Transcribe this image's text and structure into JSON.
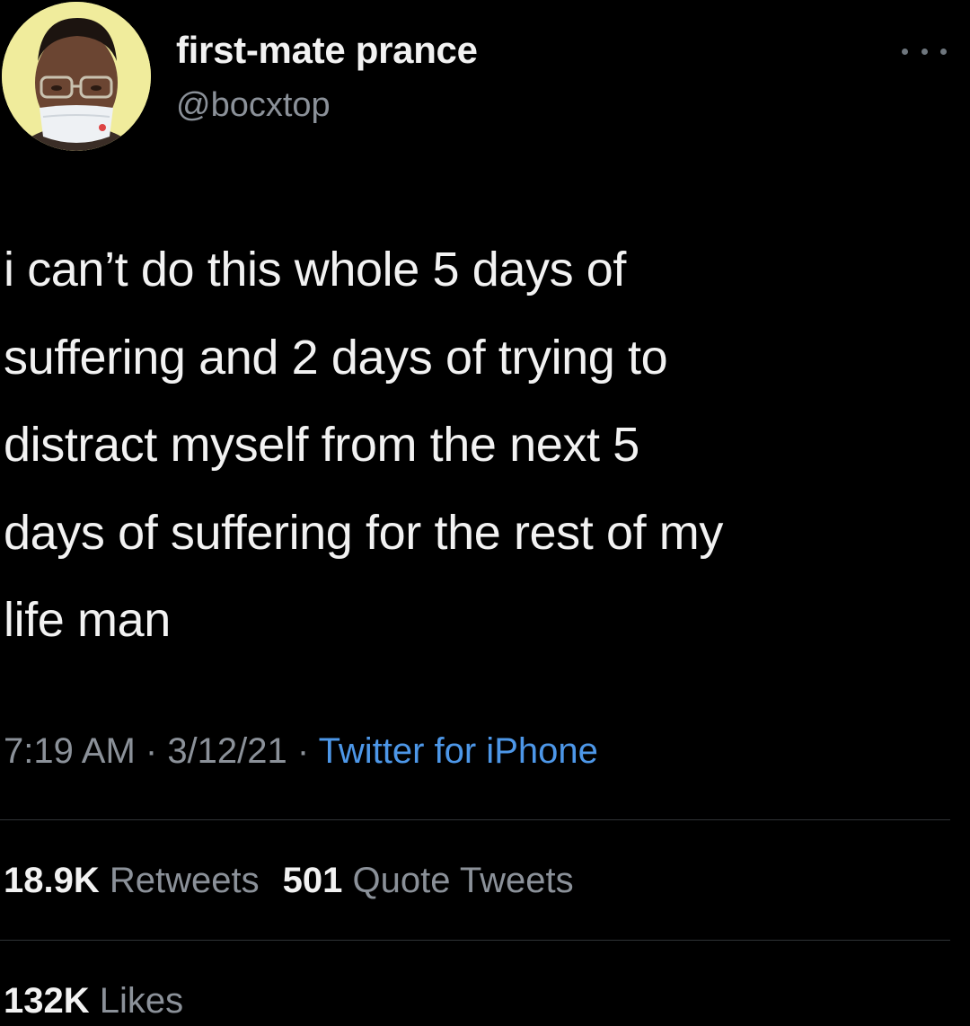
{
  "user": {
    "display_name": "first-mate prance",
    "handle": "@bocxtop",
    "avatar_icon": "profile-photo"
  },
  "more_icon": "ellipsis-icon",
  "tweet": {
    "text": "i can’t do this whole 5 days of\nsuffering and 2 days of trying to\ndistract myself from the next 5\ndays of suffering for the rest of my\nlife man"
  },
  "meta": {
    "time": "7:19 AM",
    "sep1": " · ",
    "date": "3/12/21",
    "sep2": " · ",
    "source": "Twitter for iPhone"
  },
  "stats": {
    "retweets_count": "18.9K",
    "retweets_label": "Retweets",
    "quotes_count": "501",
    "quotes_label": "Quote Tweets",
    "likes_count": "132K",
    "likes_label": "Likes"
  },
  "colors": {
    "background": "#000000",
    "text": "#f2f2f2",
    "secondary": "#8b9199",
    "link": "#4d97e8",
    "divider": "#2f3336",
    "avatar_bg": "#f0ec9c"
  }
}
